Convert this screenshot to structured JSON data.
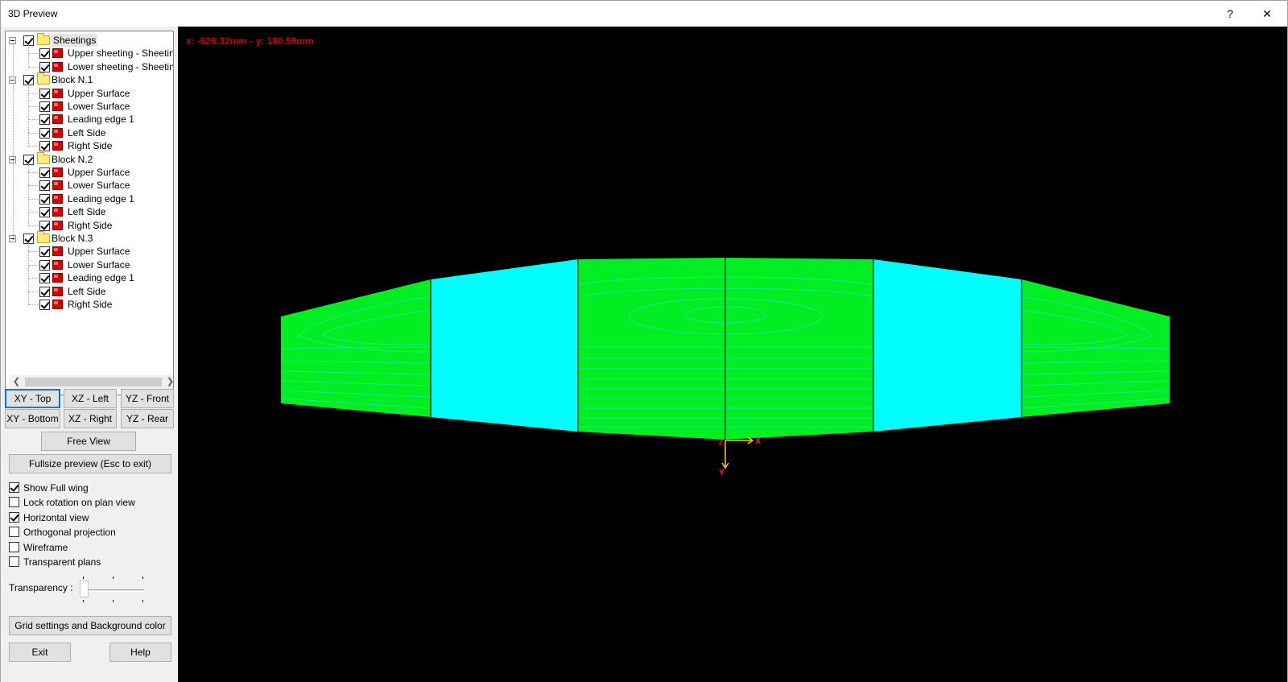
{
  "window": {
    "title": "3D Preview",
    "help_label": "?",
    "close_label": "✕"
  },
  "tree": {
    "groups": [
      {
        "label": "Sheetings",
        "items": [
          "Upper sheeting - Sheeting",
          "Lower sheeting - Sheeting"
        ]
      },
      {
        "label": "Block N.1",
        "items": [
          "Upper Surface",
          "Lower Surface",
          "Leading edge 1",
          "Left Side",
          "Right Side"
        ]
      },
      {
        "label": "Block N.2",
        "items": [
          "Upper Surface",
          "Lower Surface",
          "Leading edge 1",
          "Left Side",
          "Right Side"
        ]
      },
      {
        "label": "Block N.3",
        "items": [
          "Upper Surface",
          "Lower Surface",
          "Leading edge 1",
          "Left Side",
          "Right Side"
        ]
      }
    ]
  },
  "view_buttons": {
    "xy_top": "XY - Top",
    "xz_left": "XZ - Left",
    "yz_front": "YZ - Front",
    "xy_bottom": "XY - Bottom",
    "xz_right": "XZ - Right",
    "yz_rear": "YZ - Rear",
    "free_view": "Free View",
    "fullsize": "Fullsize preview (Esc to exit)"
  },
  "options": [
    {
      "label": "Show Full wing",
      "checked": true
    },
    {
      "label": "Lock rotation on plan view",
      "checked": false
    },
    {
      "label": "Horizontal view",
      "checked": true
    },
    {
      "label": "Orthogonal projection",
      "checked": false
    },
    {
      "label": "Wireframe",
      "checked": false
    },
    {
      "label": "Transparent plans",
      "checked": false
    }
  ],
  "transparency": {
    "label": "Transparency :",
    "value": 0
  },
  "bottom_buttons": {
    "grid_settings": "Grid settings and Background color",
    "exit": "Exit",
    "help": "Help"
  },
  "viewport": {
    "coords": "x: -626.32mm - y: 180.59mm",
    "axis_x": "X",
    "axis_y": "Y",
    "axis_z": "Z",
    "colors": {
      "background": "#000000",
      "wing_green": "#00ee22",
      "wing_cyan": "#00ffff",
      "contour": "#22e6a0",
      "coords_text": "#cc0000",
      "axis_line": "#ffcc00",
      "axis_label": "#ff2020"
    }
  }
}
